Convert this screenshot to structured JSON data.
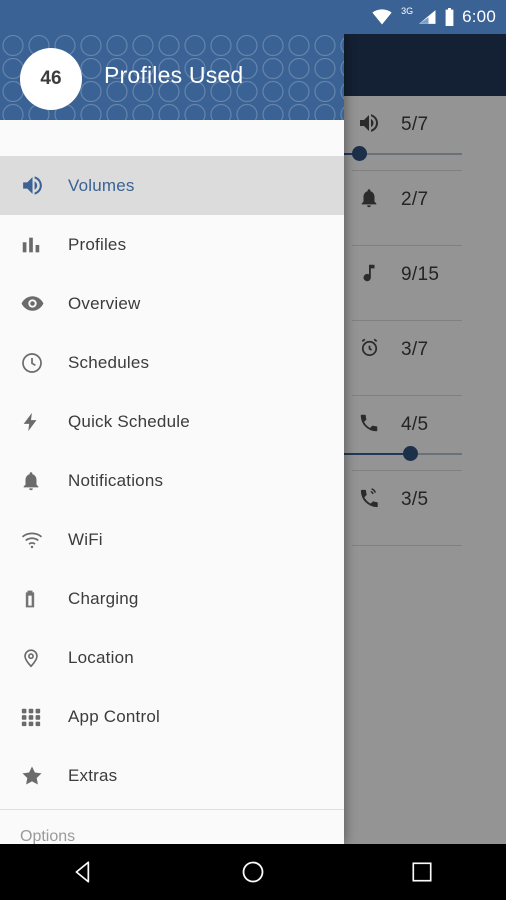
{
  "status_bar": {
    "time": "6:00",
    "network_label": "3G",
    "icons": [
      "wifi-icon",
      "signal-icon",
      "battery-icon"
    ],
    "background_color": "#3a6294"
  },
  "drawer": {
    "header": {
      "badge_count": "46",
      "title": "Profiles Used",
      "background_color": "#3a6294",
      "accent_color": "#3a6294"
    },
    "items": [
      {
        "label": "Volumes",
        "icon": "volume-icon",
        "selected": true
      },
      {
        "label": "Profiles",
        "icon": "bar-chart-icon",
        "selected": false
      },
      {
        "label": "Overview",
        "icon": "eye-icon",
        "selected": false
      },
      {
        "label": "Schedules",
        "icon": "clock-icon",
        "selected": false
      },
      {
        "label": "Quick Schedule",
        "icon": "lightning-bolt-icon",
        "selected": false
      },
      {
        "label": "Notifications",
        "icon": "bell-icon",
        "selected": false
      },
      {
        "label": "WiFi",
        "icon": "wifi-icon",
        "selected": false
      },
      {
        "label": "Charging",
        "icon": "battery-icon",
        "selected": false
      },
      {
        "label": "Location",
        "icon": "location-pin-icon",
        "selected": false
      },
      {
        "label": "App Control",
        "icon": "grid-apps-icon",
        "selected": false
      },
      {
        "label": "Extras",
        "icon": "star-icon",
        "selected": false
      }
    ],
    "footer_label": "Options"
  },
  "content": {
    "header_color": "#23395b",
    "rows": [
      {
        "icon": "speaker-media-icon",
        "value": "5/7",
        "slider": {
          "visible": true,
          "fill_percent": 71
        }
      },
      {
        "icon": "bell-icon",
        "value": "2/7",
        "slider": {
          "visible": false,
          "fill_percent": 0
        }
      },
      {
        "icon": "music-note-icon",
        "value": "9/15",
        "slider": {
          "visible": false,
          "fill_percent": 0
        }
      },
      {
        "icon": "alarm-clock-icon",
        "value": "3/7",
        "slider": {
          "visible": false,
          "fill_percent": 0
        }
      },
      {
        "icon": "phone-icon",
        "value": "4/5",
        "slider": {
          "visible": true,
          "fill_percent": 81
        }
      },
      {
        "icon": "phone-ring-icon",
        "value": "3/5",
        "slider": {
          "visible": false,
          "fill_percent": 0
        }
      }
    ]
  },
  "nav_bar": {
    "buttons": [
      "back-button",
      "home-button",
      "recents-button"
    ],
    "background_color": "#000000"
  }
}
